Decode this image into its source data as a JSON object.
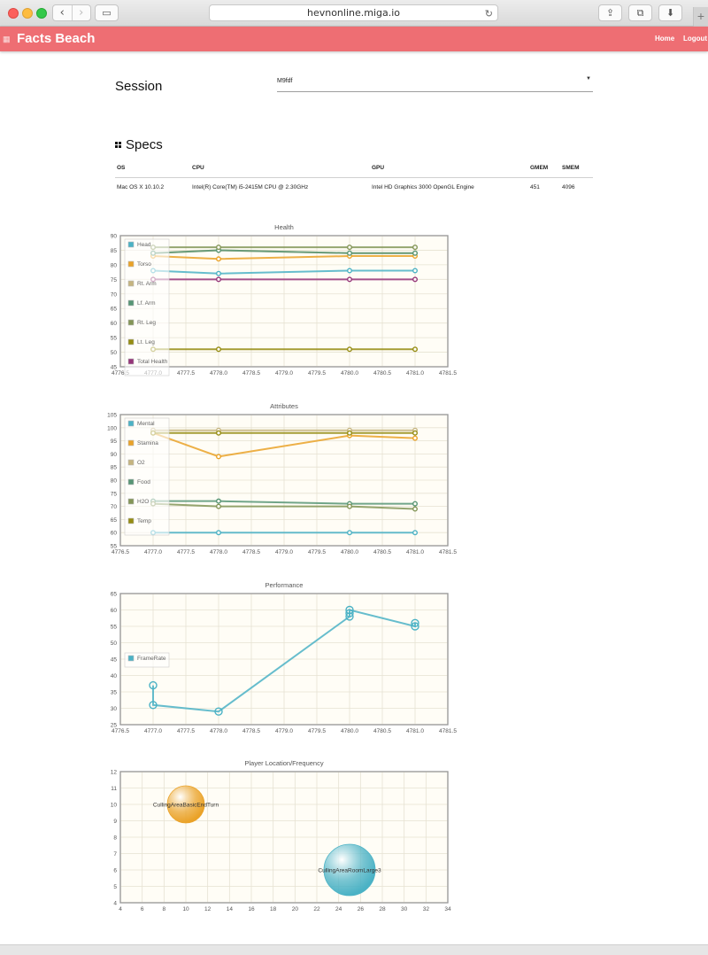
{
  "browser": {
    "url": "hevnonline.miga.io",
    "back_icon": "chevron-left-icon",
    "forward_icon": "chevron-right-icon"
  },
  "app": {
    "brand": "Facts Beach",
    "nav": [
      "Home",
      "Logout"
    ],
    "accent_color": "#ee6e73"
  },
  "session": {
    "label": "Session",
    "selected": "M9fdf"
  },
  "specs": {
    "title": "Specs",
    "columns": [
      "OS",
      "CPU",
      "GPU",
      "GMEM",
      "SMEM"
    ],
    "row": [
      "Mac OS X 10.10.2",
      "Intel(R) Core(TM) i5-2415M CPU @ 2.30GHz",
      "Intel HD Graphics 3000 OpenGL Engine",
      "451",
      "4096"
    ]
  },
  "chart_data": [
    {
      "type": "line",
      "title": "Health",
      "xlim": [
        4776.5,
        4781.5
      ],
      "ylim": [
        45,
        90
      ],
      "xticks": [
        "4776.5",
        "4777.0",
        "4777.5",
        "4778.0",
        "4778.5",
        "4779.0",
        "4779.5",
        "4780.0",
        "4780.5",
        "4781.0",
        "4781.5"
      ],
      "yticks": [
        "45",
        "50",
        "55",
        "60",
        "65",
        "70",
        "75",
        "80",
        "85",
        "90"
      ],
      "legend_position": "left",
      "grid": true,
      "series": [
        {
          "name": "Head",
          "color": "#4bb2c5",
          "points": [
            [
              4777.0,
              78
            ],
            [
              4778.0,
              77
            ],
            [
              4780.0,
              78
            ],
            [
              4781.0,
              78
            ]
          ]
        },
        {
          "name": "Torso",
          "color": "#eaa228",
          "points": [
            [
              4777.0,
              83
            ],
            [
              4778.0,
              82
            ],
            [
              4780.0,
              83
            ],
            [
              4781.0,
              83
            ]
          ]
        },
        {
          "name": "Rt. Arm",
          "color": "#c5b47f",
          "points": [
            [
              4777.0,
              84
            ],
            [
              4778.0,
              85
            ],
            [
              4780.0,
              84
            ],
            [
              4781.0,
              84
            ]
          ]
        },
        {
          "name": "Lf. Arm",
          "color": "#579575",
          "points": [
            [
              4777.0,
              84
            ],
            [
              4778.0,
              85
            ],
            [
              4780.0,
              84
            ],
            [
              4781.0,
              84
            ]
          ]
        },
        {
          "name": "Rt. Leg",
          "color": "#839557",
          "points": [
            [
              4777.0,
              86
            ],
            [
              4778.0,
              86
            ],
            [
              4780.0,
              86
            ],
            [
              4781.0,
              86
            ]
          ]
        },
        {
          "name": "Lt. Leg",
          "color": "#958c12",
          "points": [
            [
              4777.0,
              51
            ],
            [
              4778.0,
              51
            ],
            [
              4780.0,
              51
            ],
            [
              4781.0,
              51
            ]
          ]
        },
        {
          "name": "Total Health",
          "color": "#953579",
          "points": [
            [
              4777.0,
              75
            ],
            [
              4778.0,
              75
            ],
            [
              4780.0,
              75
            ],
            [
              4781.0,
              75
            ]
          ]
        }
      ]
    },
    {
      "type": "line",
      "title": "Attributes",
      "xlim": [
        4776.5,
        4781.5
      ],
      "ylim": [
        55,
        105
      ],
      "xticks": [
        "4776.5",
        "4777.0",
        "4777.5",
        "4778.0",
        "4778.5",
        "4779.0",
        "4779.5",
        "4780.0",
        "4780.5",
        "4781.0",
        "4781.5"
      ],
      "yticks": [
        "55",
        "60",
        "65",
        "70",
        "75",
        "80",
        "85",
        "90",
        "95",
        "100",
        "105"
      ],
      "legend_position": "left",
      "grid": true,
      "series": [
        {
          "name": "Mental",
          "color": "#4bb2c5",
          "points": [
            [
              4777.0,
              60
            ],
            [
              4778.0,
              60
            ],
            [
              4780.0,
              60
            ],
            [
              4781.0,
              60
            ]
          ]
        },
        {
          "name": "Stamina",
          "color": "#eaa228",
          "points": [
            [
              4777.0,
              98
            ],
            [
              4778.0,
              89
            ],
            [
              4780.0,
              97
            ],
            [
              4781.0,
              96
            ]
          ]
        },
        {
          "name": "O2",
          "color": "#c5b47f",
          "points": [
            [
              4777.0,
              99
            ],
            [
              4778.0,
              99
            ],
            [
              4780.0,
              99
            ],
            [
              4781.0,
              99
            ]
          ]
        },
        {
          "name": "Food",
          "color": "#579575",
          "points": [
            [
              4777.0,
              72
            ],
            [
              4778.0,
              72
            ],
            [
              4780.0,
              71
            ],
            [
              4781.0,
              71
            ]
          ]
        },
        {
          "name": "H2O",
          "color": "#839557",
          "points": [
            [
              4777.0,
              71
            ],
            [
              4778.0,
              70
            ],
            [
              4780.0,
              70
            ],
            [
              4781.0,
              69
            ]
          ]
        },
        {
          "name": "Temp",
          "color": "#958c12",
          "points": [
            [
              4777.0,
              98
            ],
            [
              4778.0,
              98
            ],
            [
              4780.0,
              98
            ],
            [
              4781.0,
              98
            ]
          ]
        }
      ]
    },
    {
      "type": "line",
      "title": "Performance",
      "xlim": [
        4776.5,
        4781.5
      ],
      "ylim": [
        25,
        65
      ],
      "xticks": [
        "4776.5",
        "4777.0",
        "4777.5",
        "4778.0",
        "4778.5",
        "4779.0",
        "4779.5",
        "4780.0",
        "4780.5",
        "4781.0",
        "4781.5"
      ],
      "yticks": [
        "25",
        "30",
        "35",
        "40",
        "45",
        "50",
        "55",
        "60",
        "65"
      ],
      "legend_position": "left",
      "grid": true,
      "series": [
        {
          "name": "FrameRate",
          "color": "#4bb2c5",
          "points": [
            [
              4777.0,
              37
            ],
            [
              4777.0,
              31
            ],
            [
              4778.0,
              29
            ],
            [
              4780.0,
              58
            ],
            [
              4780.0,
              59
            ],
            [
              4780.0,
              60
            ],
            [
              4781.0,
              55
            ],
            [
              4781.0,
              56
            ]
          ]
        }
      ]
    },
    {
      "type": "scatter",
      "subtype": "bubble",
      "title": "Player Location/Frequency",
      "xlim": [
        4,
        34
      ],
      "ylim": [
        4,
        12
      ],
      "xticks": [
        "4",
        "6",
        "8",
        "10",
        "12",
        "14",
        "16",
        "18",
        "20",
        "22",
        "24",
        "26",
        "28",
        "30",
        "32",
        "34"
      ],
      "yticks": [
        "4",
        "5",
        "6",
        "7",
        "8",
        "9",
        "10",
        "11",
        "12"
      ],
      "grid": true,
      "points": [
        {
          "label": "CullingAreaBasicEndTurn",
          "x": 10,
          "y": 10,
          "size": 1,
          "color": "#eaa228"
        },
        {
          "label": "CullingAreaRoomLarge3",
          "x": 25,
          "y": 6,
          "size": 2,
          "color": "#4bb2c5"
        }
      ]
    }
  ]
}
